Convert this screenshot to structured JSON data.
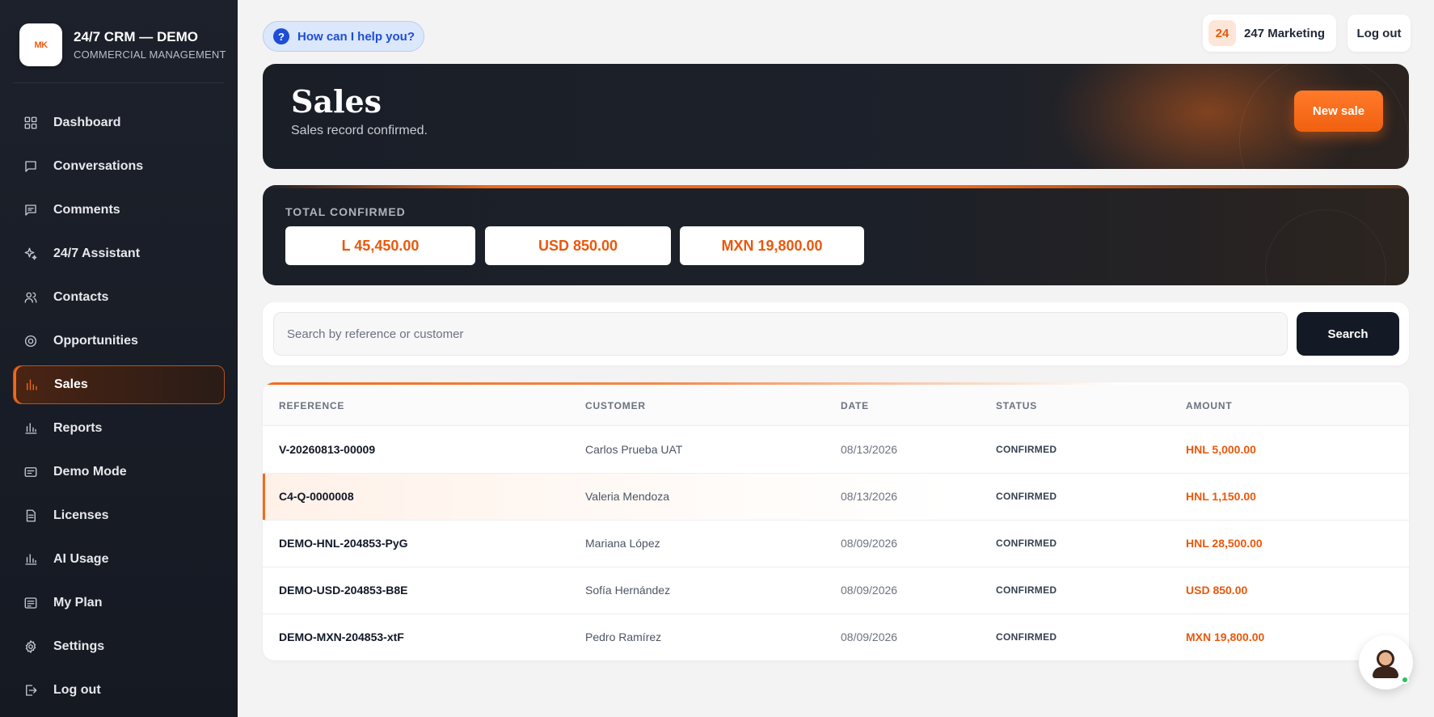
{
  "brand": {
    "logo_text": "MK",
    "title": "24/7 CRM — DEMO",
    "subtitle": "COMMERCIAL MANAGEMENT"
  },
  "sidebar": {
    "items": [
      {
        "label": "Dashboard",
        "icon": "grid-icon"
      },
      {
        "label": "Conversations",
        "icon": "chat-icon"
      },
      {
        "label": "Comments",
        "icon": "comment-icon"
      },
      {
        "label": "24/7 Assistant",
        "icon": "sparkle-icon"
      },
      {
        "label": "Contacts",
        "icon": "users-icon"
      },
      {
        "label": "Opportunities",
        "icon": "target-icon"
      },
      {
        "label": "Sales",
        "icon": "bar-chart-icon",
        "active": true
      },
      {
        "label": "Reports",
        "icon": "bar-chart-icon"
      },
      {
        "label": "Demo Mode",
        "icon": "card-icon"
      },
      {
        "label": "Licenses",
        "icon": "document-icon"
      },
      {
        "label": "AI Usage",
        "icon": "bar-chart-icon"
      },
      {
        "label": "My Plan",
        "icon": "plan-icon"
      },
      {
        "label": "Settings",
        "icon": "gear-icon"
      },
      {
        "label": "Log out",
        "icon": "logout-icon"
      }
    ]
  },
  "topbar": {
    "help_label": "How can I help you?",
    "help_icon": "?",
    "account_badge": "24",
    "account_name": "247 Marketing",
    "logout_label": "Log out"
  },
  "hero": {
    "title": "Sales",
    "subtitle": "Sales record confirmed.",
    "new_sale_label": "New sale"
  },
  "totals": {
    "label": "TOTAL CONFIRMED",
    "values": [
      "L 45,450.00",
      "USD 850.00",
      "MXN 19,800.00"
    ]
  },
  "search": {
    "placeholder": "Search by reference or customer",
    "value": "",
    "button_label": "Search"
  },
  "table": {
    "headers": [
      "REFERENCE",
      "CUSTOMER",
      "DATE",
      "STATUS",
      "AMOUNT"
    ],
    "rows": [
      {
        "reference": "V-20260813-00009",
        "customer": "Carlos Prueba UAT",
        "date": "08/13/2026",
        "status": "CONFIRMED",
        "amount": "HNL 5,000.00"
      },
      {
        "reference": "C4-Q-0000008",
        "customer": "Valeria Mendoza",
        "date": "08/13/2026",
        "status": "CONFIRMED",
        "amount": "HNL 1,150.00",
        "highlighted": true
      },
      {
        "reference": "DEMO-HNL-204853-PyG",
        "customer": "Mariana López",
        "date": "08/09/2026",
        "status": "CONFIRMED",
        "amount": "HNL 28,500.00"
      },
      {
        "reference": "DEMO-USD-204853-B8E",
        "customer": "Sofía Hernández",
        "date": "08/09/2026",
        "status": "CONFIRMED",
        "amount": "USD 850.00"
      },
      {
        "reference": "DEMO-MXN-204853-xtF",
        "customer": "Pedro Ramírez",
        "date": "08/09/2026",
        "status": "CONFIRMED",
        "amount": "MXN 19,800.00"
      }
    ]
  },
  "colors": {
    "accent": "#f26a1b",
    "sidebar_bg": "#1a1f28",
    "amount_text": "#ea580c",
    "help_blue": "#1d4ed8"
  },
  "chat_widget": {
    "icon": "assistant-avatar-icon",
    "status": "online"
  }
}
